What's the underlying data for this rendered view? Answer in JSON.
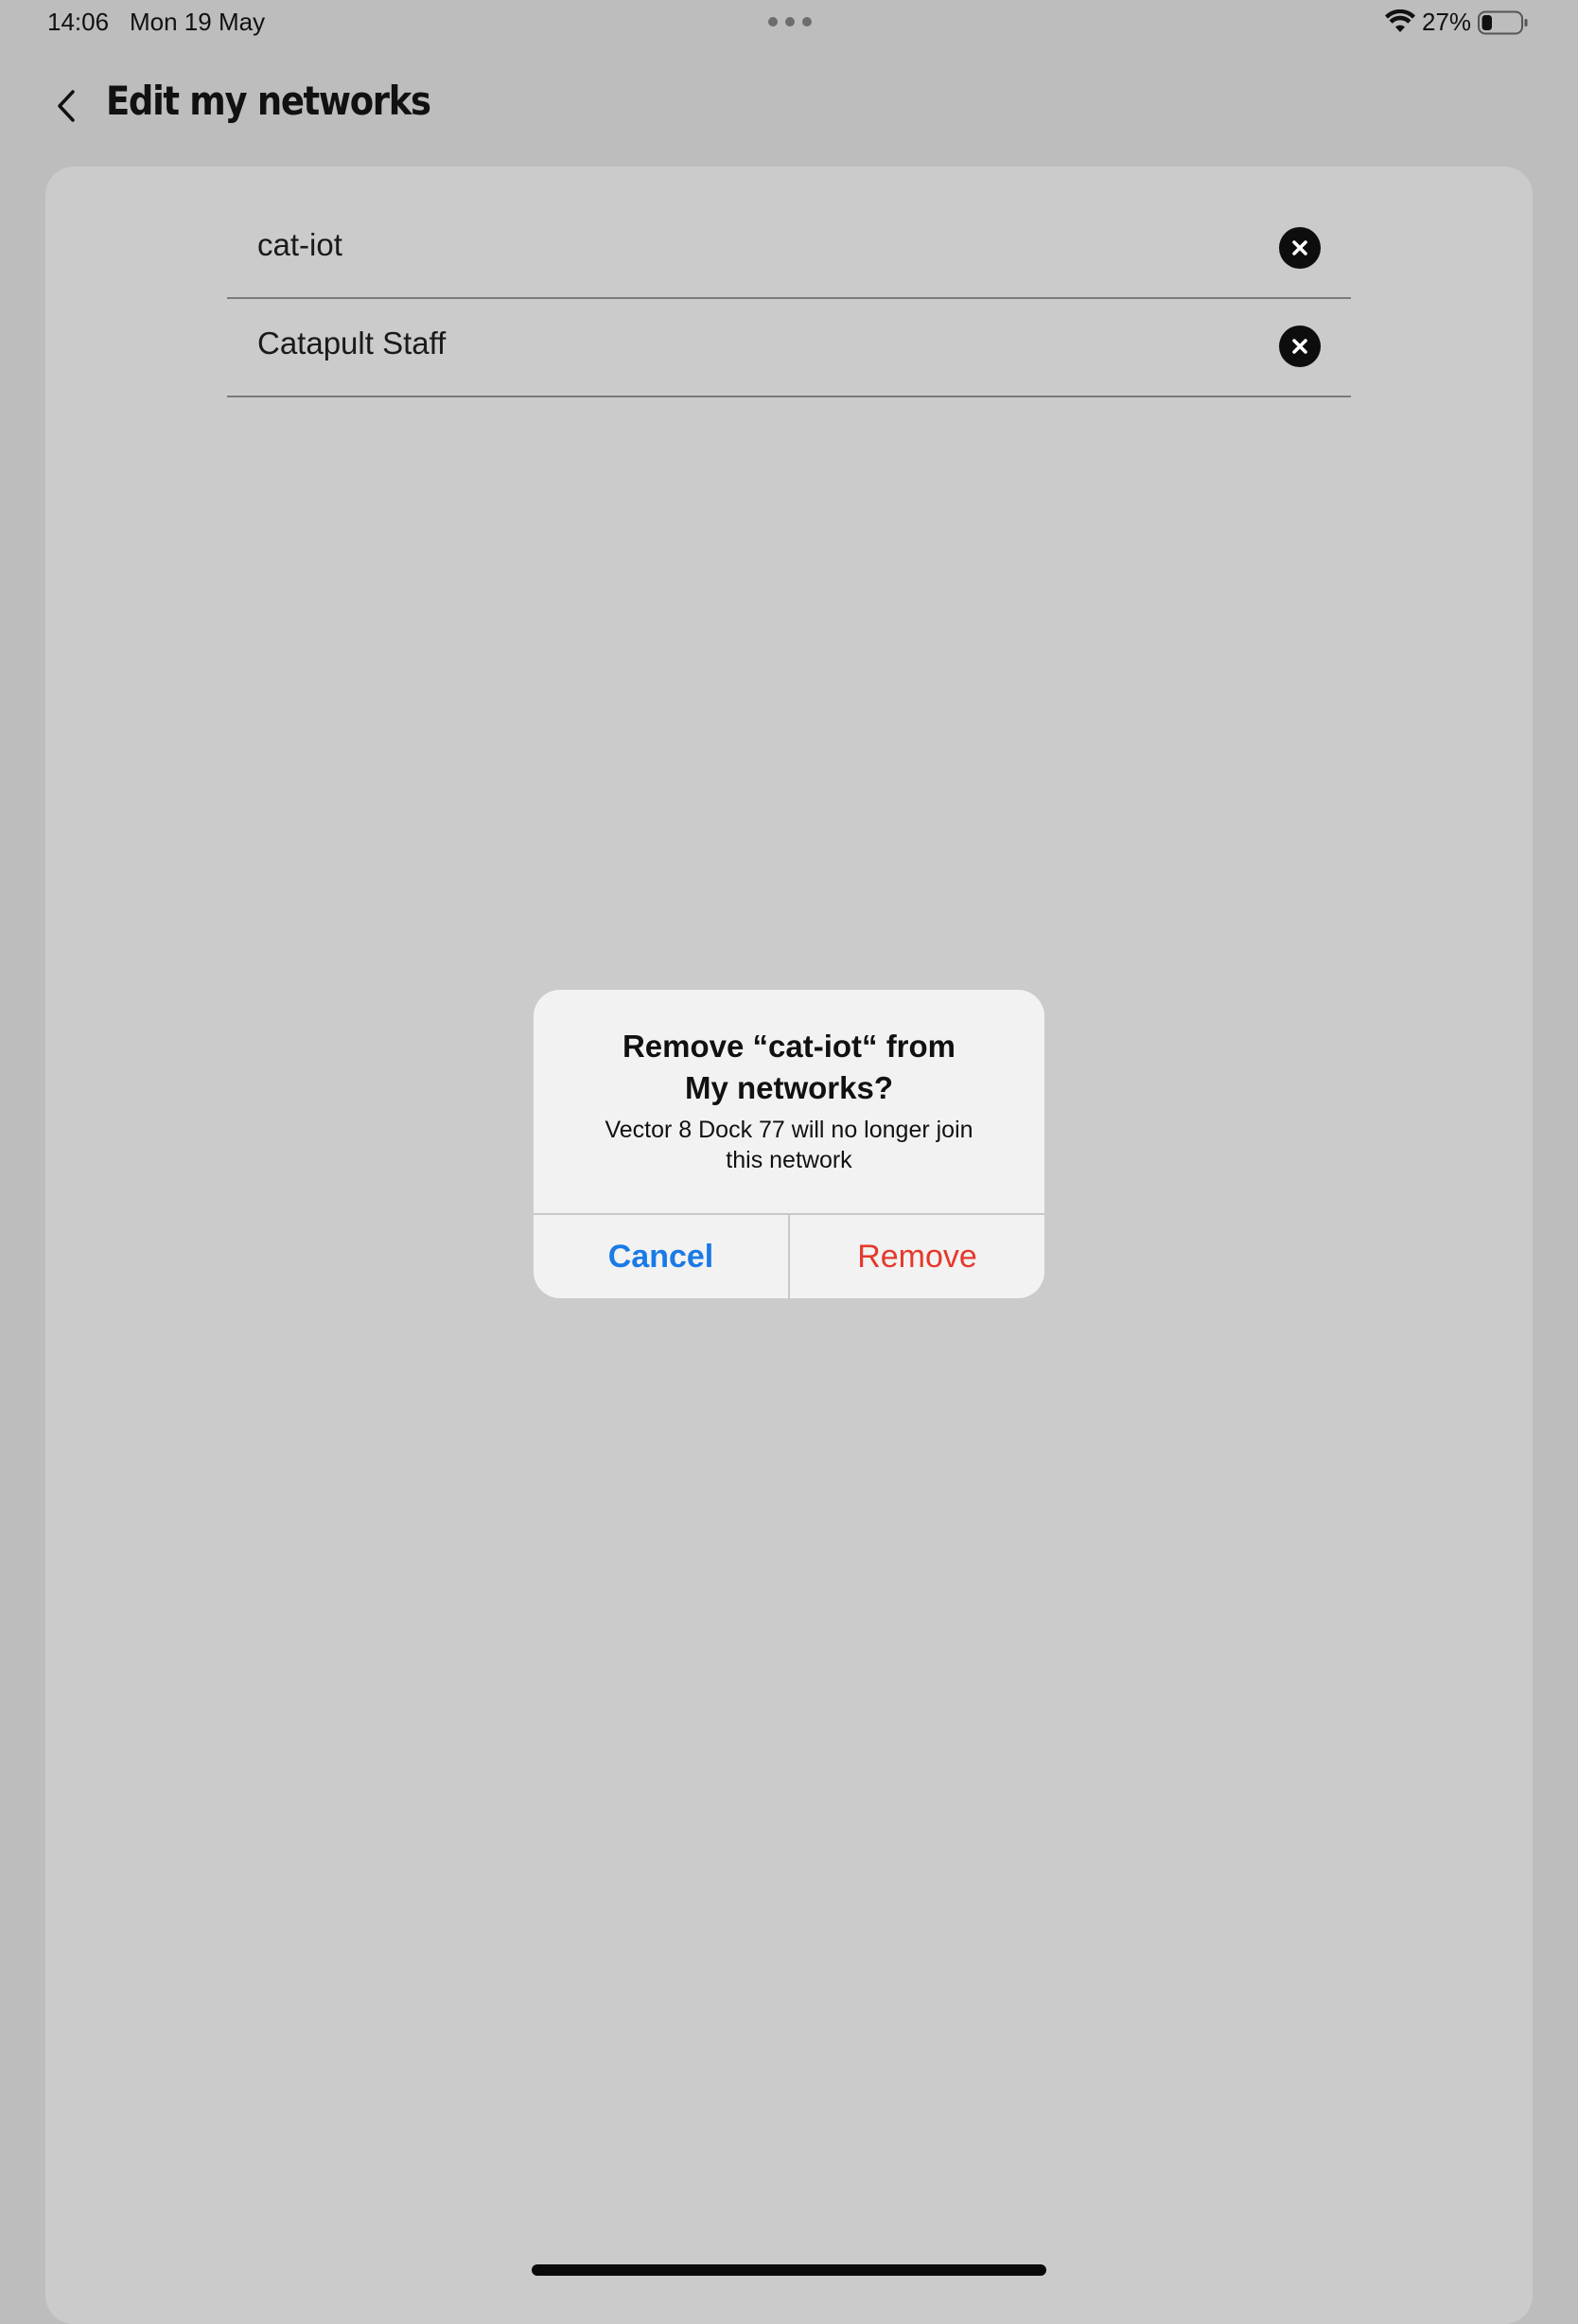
{
  "status_bar": {
    "time": "14:06",
    "date": "Mon 19 May",
    "battery_percent": "27%",
    "battery_level": 0.27,
    "multitask_icon": "ellipsis-icon",
    "wifi_icon": "wifi-icon",
    "battery_icon": "battery-icon"
  },
  "header": {
    "title": "Edit my networks",
    "back_icon": "chevron-left-icon"
  },
  "networks": [
    {
      "name": "cat-iot",
      "remove_icon": "close-circle-icon"
    },
    {
      "name": "Catapult Staff",
      "remove_icon": "close-circle-icon"
    }
  ],
  "alert": {
    "title_line1": "Remove “cat-iot“ from",
    "title_line2": "My networks?",
    "message_line1": "Vector 8 Dock 77 will no longer join",
    "message_line2": "this network",
    "cancel_label": "Cancel",
    "remove_label": "Remove"
  },
  "colors": {
    "overlay_background": "#bdbdbd",
    "card_background": "#cbcbcb",
    "dialog_background": "#f2f2f2",
    "cancel_blue": "#1a7ae6",
    "remove_red": "#e5392c"
  }
}
